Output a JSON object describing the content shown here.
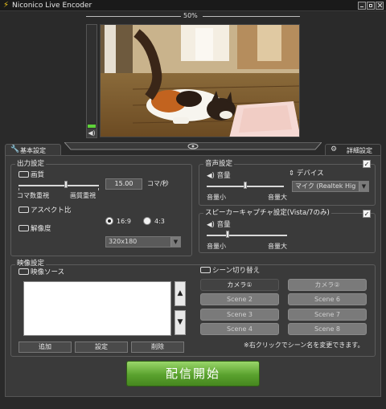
{
  "window": {
    "title": "Niconico Live Encoder"
  },
  "preview": {
    "zoom": "50%"
  },
  "tabs": {
    "basic": "基本設定",
    "advanced": "詳細設定"
  },
  "output": {
    "title": "出力設定",
    "quality_label": "画質",
    "framerate_value": "15.00",
    "framerate_unit": "コマ/秒",
    "left_label": "コマ数重視",
    "right_label": "画質重視",
    "aspect_label": "アスペクト比",
    "aspect_options": [
      "16:9",
      "4:3"
    ],
    "aspect_selected": "16:9",
    "resolution_label": "解像度",
    "resolution_value": "320x180"
  },
  "audio": {
    "title": "音声設定",
    "volume_label": "音量",
    "device_label": "デバイス",
    "device_value": "マイク (Realtek Hig",
    "min_label": "音量小",
    "max_label": "音量大",
    "enabled": true
  },
  "speaker": {
    "title": "スピーカーキャプチャ設定(Vista/7のみ)",
    "volume_label": "音量",
    "min_label": "音量小",
    "max_label": "音量大",
    "enabled": true
  },
  "video": {
    "title": "映像設定",
    "source_label": "映像ソース",
    "add": "追加",
    "settings": "設定",
    "remove": "削除"
  },
  "scene": {
    "title": "シーン切り替え",
    "buttons": [
      "カメラ①",
      "カメラ②",
      "Scene 2",
      "Scene 6",
      "Scene 3",
      "Scene 7",
      "Scene 4",
      "Scene 8"
    ],
    "hint": "※右クリックでシーン名を変更できます。"
  },
  "start_button": "配信開始",
  "colors": {
    "accent_green": "#5aa22e",
    "meter_green": "#5fd23a"
  }
}
